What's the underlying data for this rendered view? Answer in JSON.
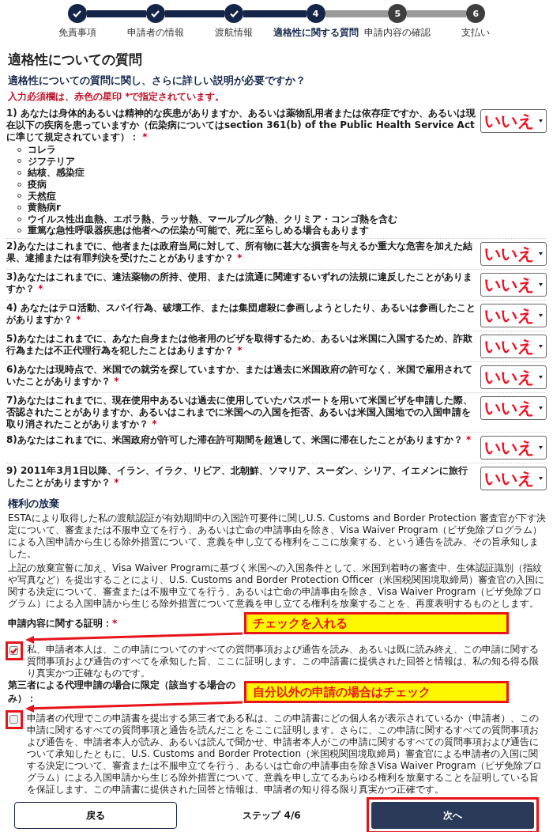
{
  "steps": [
    {
      "label": "免責事項",
      "completed": true,
      "selected": false
    },
    {
      "label": "申請者の情報",
      "completed": true,
      "selected": false
    },
    {
      "label": "渡航情報",
      "completed": true,
      "selected": false
    },
    {
      "label": "適格性に関する質問",
      "completed": false,
      "selected": true,
      "number": "4"
    },
    {
      "label": "申請内容の確認",
      "completed": false,
      "selected": false,
      "number": "5"
    },
    {
      "label": "支払い",
      "completed": false,
      "selected": false,
      "number": "6"
    }
  ],
  "heading": "適格性についての質問",
  "subheading": "適格性についての質問に関し、さらに詳しい説明が必要ですか？",
  "required_note": "入力必須欄は、赤色の星印 *で指定されています。",
  "questions": [
    {
      "text": "1) あなたは身体的あるいは精神的な疾患がありますか、あるいは薬物乱用者または依存症ですか、あるいは現在以下の疾病を患っていますか（伝染病についてはsection 361(b) of the Public Health Service Actに準じて規定されています）：",
      "required_mark": "*",
      "answer": "いいえ",
      "bullets": [
        "コレラ",
        "ジフテリア",
        "結核、感染症",
        "疫病",
        "天然痘",
        "黄熱病r",
        "ウイルス性出血熱、エボラ熱、ラッサ熱、マールブルグ熱、クリミア・コンゴ熱を含む",
        "重篤な急性呼吸器疾患は他者への伝染が可能で、死に至らしめる場合もあります"
      ]
    },
    {
      "text": "2)あなたはこれまでに、他者または政府当局に対して、所有物に甚大な損害を与えるか重大な危害を加えた結果、逮捕または有罪判決を受けたことがありますか？",
      "required_mark": "*",
      "answer": "いいえ"
    },
    {
      "text": "3)あなたはこれまでに、違法薬物の所持、使用、または流通に関連するいずれの法規に違反したことがありますか？",
      "required_mark": "*",
      "answer": "いいえ"
    },
    {
      "text": "4) あなたはテロ活動、スパイ行為、破壊工作、または集団虐殺に参画しようとしたり、あるいは参画したことがありますか？",
      "required_mark": "*",
      "answer": "いいえ"
    },
    {
      "text": "5)あなたはこれまでに、あなた自身または他者用のビザを取得するため、あるいは米国に入国するため、詐欺行為または不正代理行為を犯したことはありますか？",
      "required_mark": "*",
      "answer": "いいえ"
    },
    {
      "text": "6)あなたは現時点で、米国での就労を探していますか、または過去に米国政府の許可なく、米国で雇用されていたことがありますか？",
      "required_mark": "*",
      "answer": "いいえ"
    },
    {
      "text": "7)あなたはこれまでに、現在使用中あるいは過去に使用していたパスポートを用いて米国ビザを申請した際、否認されたことがありますか、あるいはこれまでに米国への入国を拒否、あるいは米国入国地での入国申請を取り消されたことがありますか？",
      "required_mark": "*",
      "answer": "いいえ"
    },
    {
      "text": "8)あなたはこれまでに、米国政府が許可した滞在許可期間を超過して、米国に滞在したことがありますか？",
      "required_mark": "*",
      "answer": "いいえ"
    },
    {
      "text": "9) 2011年3月1日以降、イラン、イラク、リビア、北朝鮮、ソマリア、スーダン、シリア、イエメンに旅行したことがありますか？",
      "required_mark": "*",
      "answer": "いいえ"
    }
  ],
  "waiver": {
    "title": "権利の放棄",
    "paragraphs": [
      "ESTAにより取得した私の渡航認証が有効期間中の入国許可要件に関しU.S. Customs and Border Protection 審査官が下す決定について、審査または不服申立てを行う、あるいは亡命の申請事由を除き、Visa Waiver Program（ビザ免除プログラム）による入国申請から生じる除外措置について、意義を申し立てる権利をここに放棄する、という通告を読み、その旨承知しました。",
      "上記の放棄宣誓に加え、Visa Waiver Programに基づく米国への入国条件として、米国到着時の審査中、生体認証識別（指紋や写真など）を提出することにより、U.S. Customs and Border Protection Officer（米国税関国境取締局）審査官の入国に関する決定について、審査または不服申立てを行う、あるいは亡命の申請事由を除き、Visa Waiver Program（ビザ免除プログラム）による入国申請から生じる除外措置について意義を申し立てる権利を放棄することを、再度表明するものとします。"
    ]
  },
  "certification": {
    "title": "申請内容に関する証明：",
    "required_mark": "*",
    "checked": true,
    "highlighted": true,
    "callout": "チェックを入れる",
    "text": "私、申請者本人は、この申請についてのすべての質問事項および通告を読み、あるいは既に読み終え、この申請に関する質問事項および通告のすべてを承知した旨、ここに証明します。この申請書に提供された回答と情報は、私の知る得る限り真実かつ正確なものです。"
  },
  "third_party": {
    "title": "第三者による代理申請の場合に限定（該当する場合のみ）：",
    "checked": false,
    "highlighted": true,
    "callout": "自分以外の申請の場合はチェック",
    "text": "申請者の代理でこの申請書を提出する第三者である私は、この申請書にどの個人名が表示されているか（申請者）、この申請に関するすべての質問事項と通告を読んだことをここに証明します。さらに、この申請に関するすべての質問事項および通告を、申請者本人が読み、あるいは読んで聞かせ、申請者本人がこの申請に関するすべての質問事項および通告について承知したともに、U.S. Customs and Border Protection（米国税関国境取締局）審査官による申請者の入国に関する決定について、審査または不服申立てを行う、あるいは亡命の申請事由を除きVisa Waiver Program（ビザ免除プログラム）による入国申請から生じる除外措置について、意義を申し立てるあらゆる権利を放棄することを証明している旨を保証します。この申請書に提供された回答と情報は、申請者の知り得る限り真実かつ正確です。"
  },
  "footer": {
    "back": "戻る",
    "step": "ステップ 4/6",
    "next": "次へ",
    "next_highlighted": true
  }
}
